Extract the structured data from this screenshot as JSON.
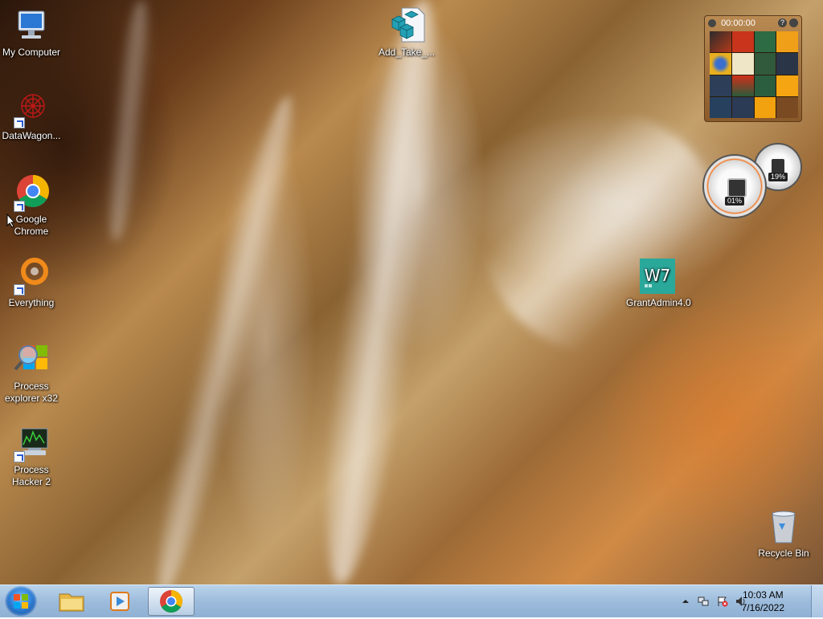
{
  "desktop": {
    "icons": [
      {
        "label": "My Computer",
        "icon": "computer-icon"
      },
      {
        "label": "DataWagon...",
        "icon": "datawagon-icon"
      },
      {
        "label": "Google Chrome",
        "icon": "chrome-icon"
      },
      {
        "label": "Everything",
        "icon": "everything-icon"
      },
      {
        "label": "Process explorer x32",
        "icon": "process-explorer-icon"
      },
      {
        "label": "Process Hacker 2",
        "icon": "process-hacker-icon"
      },
      {
        "label": "Add_Take_...",
        "icon": "registry-file-icon"
      },
      {
        "label": "GrantAdmin4.0",
        "icon": "w7-app-icon"
      },
      {
        "label": "Recycle Bin",
        "icon": "recycle-bin-icon"
      }
    ]
  },
  "gadgets": {
    "puzzle": {
      "timer": "00:00:00",
      "help_label": "?"
    },
    "cpu_meter": {
      "cpu_percent": "01%",
      "memory_percent": "19%"
    }
  },
  "taskbar": {
    "pinned": [
      "windows-explorer-icon",
      "media-player-icon",
      "chrome-icon"
    ],
    "clock": {
      "time": "10:03 AM",
      "date": "7/16/2022"
    }
  },
  "colors": {
    "taskbar_top": "#b9d3ea",
    "taskbar_bottom": "#8fb0d4",
    "puzzle_frame": "#8a5a2a"
  }
}
